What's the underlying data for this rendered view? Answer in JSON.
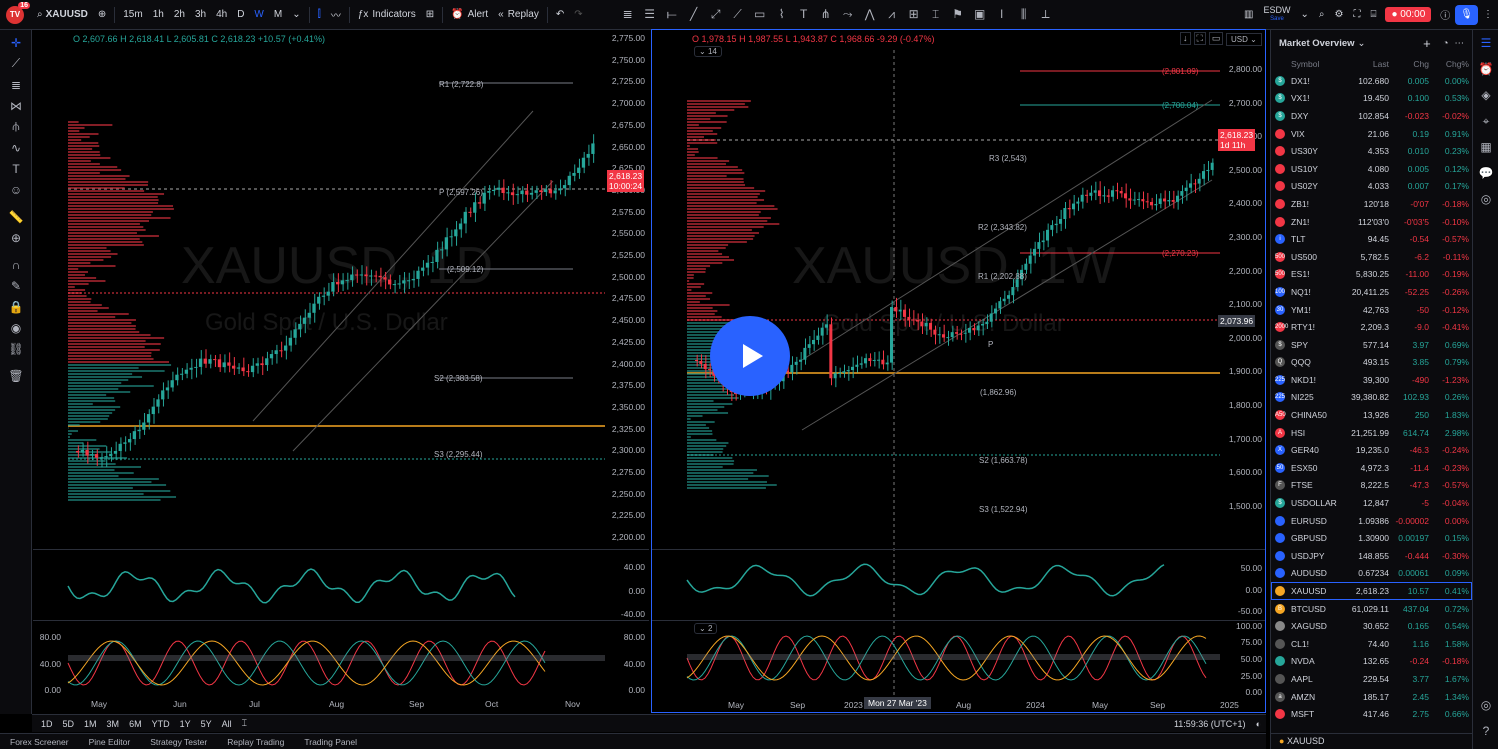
{
  "topbar": {
    "logo_badge": "16",
    "symbol": "XAUUSD",
    "intervals": [
      "15m",
      "1h",
      "2h",
      "3h",
      "4h",
      "D",
      "W",
      "M"
    ],
    "active_interval": "W",
    "indicators_label": "Indicators",
    "alert_label": "Alert",
    "replay_label": "Replay",
    "layout_name": "ESDW",
    "layout_sub": "Save",
    "record_time": "00:00"
  },
  "chart_left": {
    "ohlc": {
      "o": "O 2,607.66",
      "h": "H 2,618.41",
      "l": "L 2,605.81",
      "c": "C 2,618.23",
      "chg": "+10.57 (+0.41%)"
    },
    "watermark": "XAUUSD, 1D",
    "watermark_sub": "Gold Spot / U.S. Dollar",
    "price_ticks": [
      "2,775.00",
      "2,750.00",
      "2,725.00",
      "2,700.00",
      "2,675.00",
      "2,650.00",
      "2,625.00",
      "2,600.00",
      "2,575.00",
      "2,550.00",
      "2,525.00",
      "2,500.00",
      "2,475.00",
      "2,450.00",
      "2,425.00",
      "2,400.00",
      "2,375.00",
      "2,350.00",
      "2,325.00",
      "2,300.00",
      "2,275.00",
      "2,250.00",
      "2,225.00",
      "2,200.00"
    ],
    "price_tag": "2,618.23",
    "price_tag_time": "10:00:24",
    "levels": [
      "R1 (2,722.8)",
      "P (2,597.26)",
      "(2,509.12)",
      "S2 (2,383.58)",
      "S3 (2,295.44)"
    ],
    "osc_ticks": [
      "40.00",
      "0.00",
      "-40.00"
    ],
    "stoch_ticks": [
      "80.00",
      "40.00",
      "0.00"
    ],
    "stoch_ticks_right": [
      "80.00",
      "40.00",
      "0.00"
    ],
    "time_ticks": [
      "May",
      "Jun",
      "Jul",
      "Aug",
      "Sep",
      "Oct",
      "Nov"
    ]
  },
  "chart_right": {
    "ohlc": {
      "o": "O 1,978.15",
      "h": "H 1,987.55",
      "l": "L 1,943.87",
      "c": "C 1,968.66",
      "chg": "-9.29 (-0.47%)"
    },
    "collapse_count": "14",
    "watermark": "XAUUSD, 1W",
    "watermark_sub": "Gold Spot / U.S. Dollar",
    "currency": "USD",
    "price_ticks": [
      "2,800.00",
      "2,700.00",
      "2,600.00",
      "2,500.00",
      "2,400.00",
      "2,300.00",
      "2,200.00",
      "2,100.00",
      "2,000.00",
      "1,900.00",
      "1,800.00",
      "1,700.00",
      "1,600.00",
      "1,500.00"
    ],
    "price_tag": "2,618.23",
    "price_tag_time": "1d 11h",
    "price_tag2": "2,073.96",
    "levels": [
      "(2,801.09)",
      "(2,700.04)",
      "R3 (2,543)",
      "R2 (2,343.82)",
      "(2,270.23)",
      "R1 (2,202.88)",
      "P",
      "(1,862.96)",
      "S2 (1,663.78)",
      "S3 (1,522.94)"
    ],
    "osc_ticks": [
      "50.00",
      "0.00",
      "-50.00"
    ],
    "stoch_collapse": "2",
    "stoch_ticks": [
      "100.00",
      "75.00",
      "50.00",
      "25.00",
      "0.00"
    ],
    "time_ticks": [
      "May",
      "Sep",
      "2023",
      "Aug",
      "2024",
      "May",
      "Sep",
      "2025"
    ],
    "crosshair_date": "Mon 27 Mar '23"
  },
  "bottom_range": [
    "1D",
    "5D",
    "1M",
    "3M",
    "6M",
    "YTD",
    "1Y",
    "5Y",
    "All"
  ],
  "clock": "11:59:36 (UTC+1)",
  "bottom_tabs": [
    "Forex Screener",
    "Pine Editor",
    "Strategy Tester",
    "Replay Trading",
    "Trading Panel"
  ],
  "watchlist": {
    "title": "Market Overview",
    "columns": [
      "Symbol",
      "Last",
      "Chg",
      "Chg%"
    ],
    "rows": [
      {
        "icon": "$",
        "color": "#26a69a",
        "sym": "DX1!",
        "last": "102.680",
        "chg": "0.005",
        "chgp": "0.00%",
        "dir": "pos"
      },
      {
        "icon": "$",
        "color": "#26a69a",
        "sym": "VX1!",
        "last": "19.450",
        "chg": "0.100",
        "chgp": "0.53%",
        "dir": "pos"
      },
      {
        "icon": "$",
        "color": "#26a69a",
        "sym": "DXY",
        "last": "102.854",
        "chg": "-0.023",
        "chgp": "-0.02%",
        "dir": "neg"
      },
      {
        "icon": "",
        "color": "#f23645",
        "sym": "VIX",
        "last": "21.06",
        "chg": "0.19",
        "chgp": "0.91%",
        "dir": "pos"
      },
      {
        "icon": "",
        "color": "#f23645",
        "sym": "US30Y",
        "last": "4.353",
        "chg": "0.010",
        "chgp": "0.23%",
        "dir": "pos"
      },
      {
        "icon": "",
        "color": "#f23645",
        "sym": "US10Y",
        "last": "4.080",
        "chg": "0.005",
        "chgp": "0.12%",
        "dir": "pos"
      },
      {
        "icon": "",
        "color": "#f23645",
        "sym": "US02Y",
        "last": "4.033",
        "chg": "0.007",
        "chgp": "0.17%",
        "dir": "pos"
      },
      {
        "icon": "",
        "color": "#f23645",
        "sym": "ZB1!",
        "last": "120'18",
        "chg": "-0'07",
        "chgp": "-0.18%",
        "dir": "neg"
      },
      {
        "icon": "",
        "color": "#f23645",
        "sym": "ZN1!",
        "last": "112'03'0",
        "chg": "-0'03'5",
        "chgp": "-0.10%",
        "dir": "neg"
      },
      {
        "icon": "i",
        "color": "#2962ff",
        "sym": "TLT",
        "last": "94.45",
        "chg": "-0.54",
        "chgp": "-0.57%",
        "dir": "neg"
      },
      {
        "icon": "500",
        "color": "#f23645",
        "sym": "US500",
        "last": "5,782.5",
        "chg": "-6.2",
        "chgp": "-0.11%",
        "dir": "neg"
      },
      {
        "icon": "500",
        "color": "#f23645",
        "sym": "ES1!",
        "last": "5,830.25",
        "chg": "-11.00",
        "chgp": "-0.19%",
        "dir": "neg"
      },
      {
        "icon": "100",
        "color": "#2962ff",
        "sym": "NQ1!",
        "last": "20,411.25",
        "chg": "-52.25",
        "chgp": "-0.26%",
        "dir": "neg"
      },
      {
        "icon": "30",
        "color": "#2962ff",
        "sym": "YM1!",
        "last": "42,763",
        "chg": "-50",
        "chgp": "-0.12%",
        "dir": "neg"
      },
      {
        "icon": "2000",
        "color": "#f23645",
        "sym": "RTY1!",
        "last": "2,209.3",
        "chg": "-9.0",
        "chgp": "-0.41%",
        "dir": "neg"
      },
      {
        "icon": "$",
        "color": "#555",
        "sym": "SPY",
        "last": "577.14",
        "chg": "3.97",
        "chgp": "0.69%",
        "dir": "pos"
      },
      {
        "icon": "Q",
        "color": "#555",
        "sym": "QQQ",
        "last": "493.15",
        "chg": "3.85",
        "chgp": "0.79%",
        "dir": "pos"
      },
      {
        "icon": "225",
        "color": "#2962ff",
        "sym": "NKD1!",
        "last": "39,300",
        "chg": "-490",
        "chgp": "-1.23%",
        "dir": "neg"
      },
      {
        "icon": "225",
        "color": "#2962ff",
        "sym": "NI225",
        "last": "39,380.82",
        "chg": "102.93",
        "chgp": "0.26%",
        "dir": "pos"
      },
      {
        "icon": "A50",
        "color": "#f23645",
        "sym": "CHINA50",
        "last": "13,926",
        "chg": "250",
        "chgp": "1.83%",
        "dir": "pos"
      },
      {
        "icon": "A",
        "color": "#f23645",
        "sym": "HSI",
        "last": "21,251.99",
        "chg": "614.74",
        "chgp": "2.98%",
        "dir": "pos"
      },
      {
        "icon": "X",
        "color": "#2962ff",
        "sym": "GER40",
        "last": "19,235.0",
        "chg": "-46.3",
        "chgp": "-0.24%",
        "dir": "neg"
      },
      {
        "icon": "50",
        "color": "#2962ff",
        "sym": "ESX50",
        "last": "4,972.3",
        "chg": "-11.4",
        "chgp": "-0.23%",
        "dir": "neg"
      },
      {
        "icon": "F",
        "color": "#555",
        "sym": "FTSE",
        "last": "8,222.5",
        "chg": "-47.3",
        "chgp": "-0.57%",
        "dir": "neg"
      },
      {
        "icon": "$",
        "color": "#26a69a",
        "sym": "USDOLLAR",
        "last": "12,847",
        "chg": "-5",
        "chgp": "-0.04%",
        "dir": "neg"
      },
      {
        "icon": "",
        "color": "#2962ff",
        "sym": "EURUSD",
        "last": "1.09386",
        "chg": "-0.00002",
        "chgp": "0.00%",
        "dir": "neg"
      },
      {
        "icon": "",
        "color": "#2962ff",
        "sym": "GBPUSD",
        "last": "1.30900",
        "chg": "0.00197",
        "chgp": "0.15%",
        "dir": "pos"
      },
      {
        "icon": "",
        "color": "#2962ff",
        "sym": "USDJPY",
        "last": "148.855",
        "chg": "-0.444",
        "chgp": "-0.30%",
        "dir": "neg"
      },
      {
        "icon": "",
        "color": "#2962ff",
        "sym": "AUDUSD",
        "last": "0.67234",
        "chg": "0.00061",
        "chgp": "0.09%",
        "dir": "pos"
      },
      {
        "icon": "",
        "color": "#f5a623",
        "sym": "XAUUSD",
        "last": "2,618.23",
        "chg": "10.57",
        "chgp": "0.41%",
        "dir": "pos",
        "selected": true
      },
      {
        "icon": "B",
        "color": "#f5a623",
        "sym": "BTCUSD",
        "last": "61,029.11",
        "chg": "437.04",
        "chgp": "0.72%",
        "dir": "pos"
      },
      {
        "icon": "",
        "color": "#888",
        "sym": "XAGUSD",
        "last": "30.652",
        "chg": "0.165",
        "chgp": "0.54%",
        "dir": "pos"
      },
      {
        "icon": "",
        "color": "#555",
        "sym": "CL1!",
        "last": "74.40",
        "chg": "1.16",
        "chgp": "1.58%",
        "dir": "pos"
      },
      {
        "icon": "",
        "color": "#26a69a",
        "sym": "NVDA",
        "last": "132.65",
        "chg": "-0.24",
        "chgp": "-0.18%",
        "dir": "neg"
      },
      {
        "icon": "",
        "color": "#555",
        "sym": "AAPL",
        "last": "229.54",
        "chg": "3.77",
        "chgp": "1.67%",
        "dir": "pos"
      },
      {
        "icon": "a",
        "color": "#555",
        "sym": "AMZN",
        "last": "185.17",
        "chg": "2.45",
        "chgp": "1.34%",
        "dir": "pos"
      },
      {
        "icon": "",
        "color": "#f23645",
        "sym": "MSFT",
        "last": "417.46",
        "chg": "2.75",
        "chgp": "0.66%",
        "dir": "pos"
      }
    ],
    "footer_symbol": "XAUUSD"
  }
}
